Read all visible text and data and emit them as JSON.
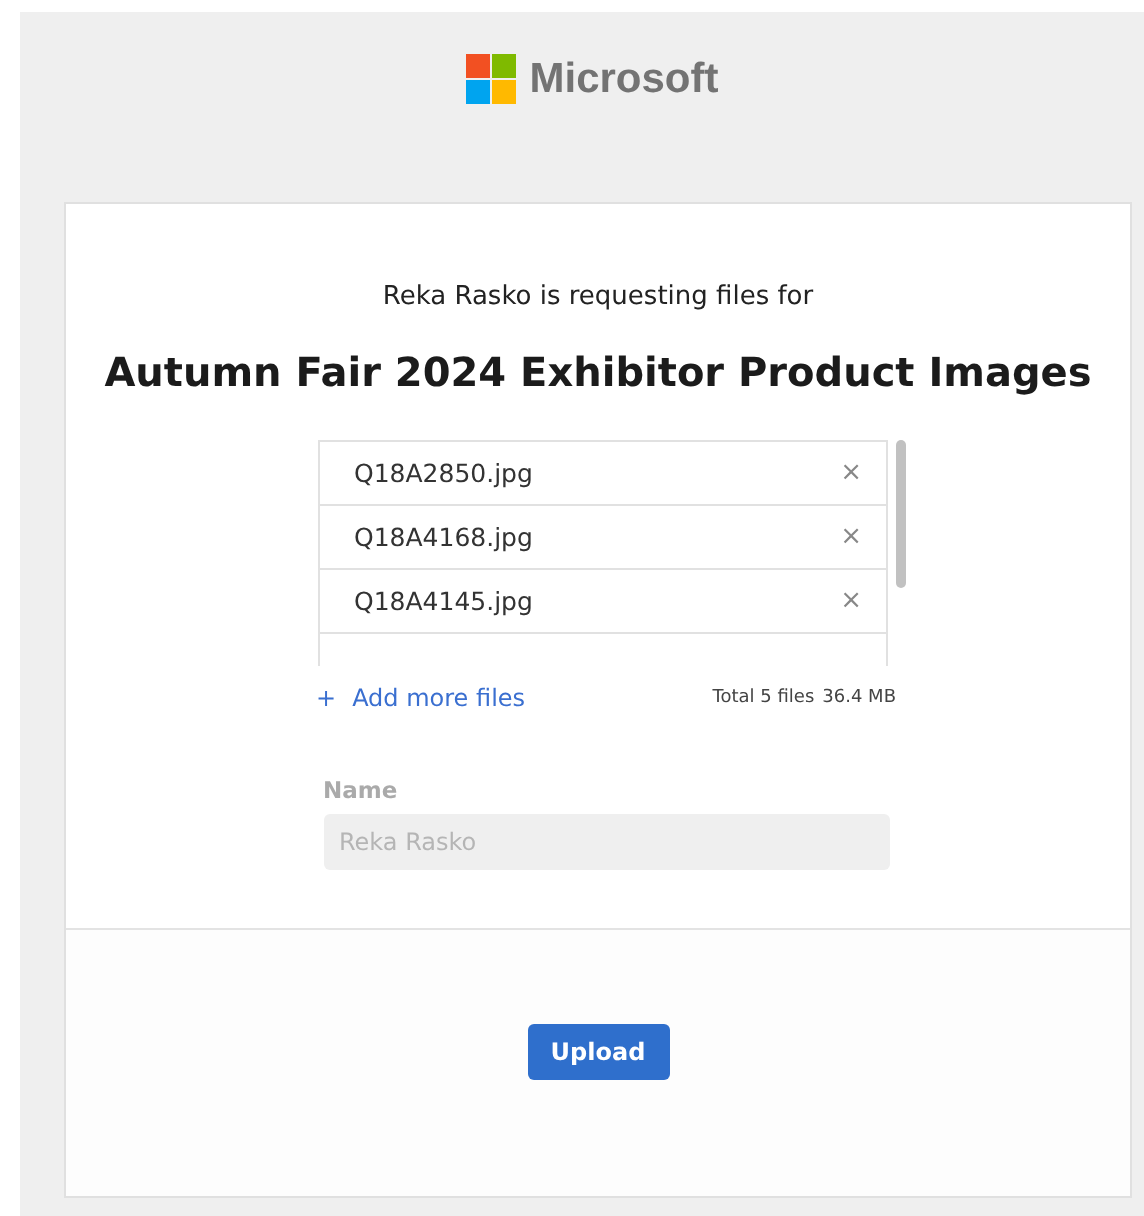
{
  "brand": {
    "name": "Microsoft"
  },
  "request": {
    "subtitle": "Reka Rasko is requesting files for",
    "title": "Autumn Fair 2024 Exhibitor Product Images"
  },
  "files": [
    {
      "name": "Q18A2850.jpg",
      "remove": "×"
    },
    {
      "name": "Q18A4168.jpg",
      "remove": "×"
    },
    {
      "name": "Q18A4145.jpg",
      "remove": "×"
    }
  ],
  "add_files": {
    "icon": "+",
    "label": "Add more files"
  },
  "total": {
    "count": "Total 5 files",
    "size": "36.4 MB"
  },
  "name_field": {
    "label": "Name",
    "value": "Reka Rasko",
    "disabled": true
  },
  "buttons": [
    "Upload"
  ]
}
